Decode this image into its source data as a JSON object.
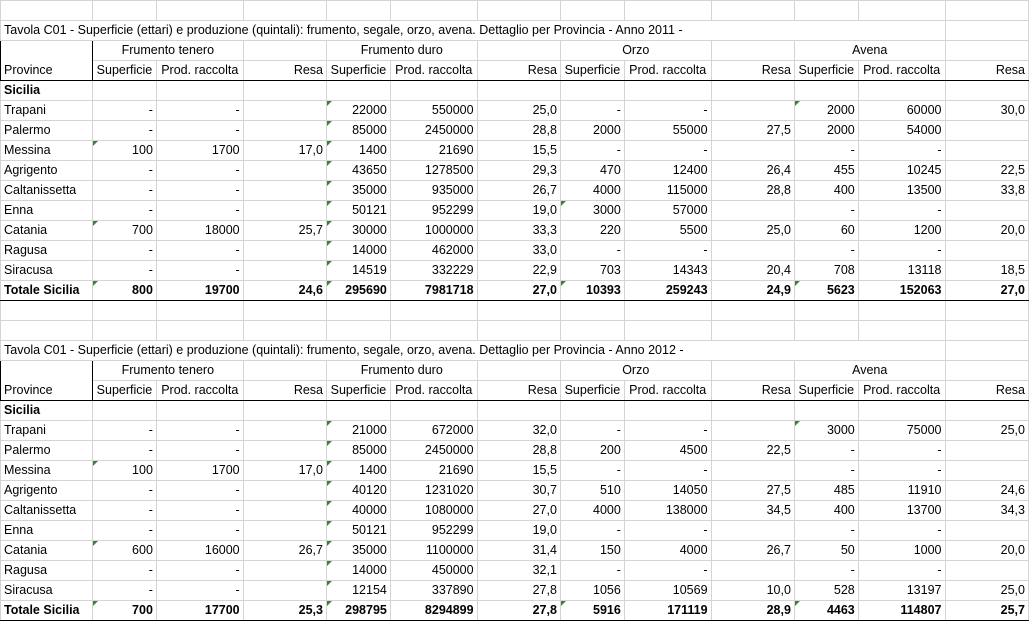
{
  "tables": [
    {
      "title": "Tavola C01 - Superficie (ettari) e produzione (quintali): frumento, segale, orzo, avena. Dettaglio per Provincia - Anno 2011 -",
      "province_header": "Province",
      "groups": [
        "Frumento tenero",
        "Frumento duro",
        "Orzo",
        "Avena"
      ],
      "subheaders": [
        "Superficie",
        "Prod. raccolta",
        "Resa",
        "Superficie",
        "Prod. raccolta",
        "Resa",
        "Superficie",
        "Prod. raccolta",
        "Resa",
        "Superficie",
        "Prod. raccolta",
        "Resa"
      ],
      "region": "Sicilia",
      "rows": [
        {
          "name": "Trapani",
          "values": [
            "-",
            "-",
            "",
            "22000",
            "550000",
            "25,0",
            "-",
            "-",
            "",
            "2000",
            "60000",
            "30,0"
          ]
        },
        {
          "name": "Palermo",
          "values": [
            "-",
            "-",
            "",
            "85000",
            "2450000",
            "28,8",
            "2000",
            "55000",
            "27,5",
            "2000",
            "54000",
            ""
          ]
        },
        {
          "name": "Messina",
          "values": [
            "100",
            "1700",
            "17,0",
            "1400",
            "21690",
            "15,5",
            "-",
            "-",
            "",
            "-",
            "-",
            ""
          ]
        },
        {
          "name": "Agrigento",
          "values": [
            "-",
            "-",
            "",
            "43650",
            "1278500",
            "29,3",
            "470",
            "12400",
            "26,4",
            "455",
            "10245",
            "22,5"
          ]
        },
        {
          "name": "Caltanissetta",
          "values": [
            "-",
            "-",
            "",
            "35000",
            "935000",
            "26,7",
            "4000",
            "115000",
            "28,8",
            "400",
            "13500",
            "33,8"
          ]
        },
        {
          "name": "Enna",
          "values": [
            "-",
            "-",
            "",
            "50121",
            "952299",
            "19,0",
            "3000",
            "57000",
            "",
            "-",
            "-",
            ""
          ]
        },
        {
          "name": "Catania",
          "values": [
            "700",
            "18000",
            "25,7",
            "30000",
            "1000000",
            "33,3",
            "220",
            "5500",
            "25,0",
            "60",
            "1200",
            "20,0"
          ]
        },
        {
          "name": "Ragusa",
          "values": [
            "-",
            "-",
            "",
            "14000",
            "462000",
            "33,0",
            "-",
            "-",
            "",
            "-",
            "-",
            ""
          ]
        },
        {
          "name": "Siracusa",
          "values": [
            "-",
            "-",
            "",
            "14519",
            "332229",
            "22,9",
            "703",
            "14343",
            "20,4",
            "708",
            "13118",
            "18,5"
          ]
        }
      ],
      "total": {
        "name": "Totale Sicilia",
        "values": [
          "800",
          "19700",
          "24,6",
          "295690",
          "7981718",
          "27,0",
          "10393",
          "259243",
          "24,9",
          "5623",
          "152063",
          "27,0"
        ]
      }
    },
    {
      "title": "Tavola C01 - Superficie (ettari) e produzione (quintali): frumento, segale, orzo, avena. Dettaglio per Provincia - Anno 2012 -",
      "province_header": "Province",
      "groups": [
        "Frumento tenero",
        "Frumento duro",
        "Orzo",
        "Avena"
      ],
      "subheaders": [
        "Superficie",
        "Prod. raccolta",
        "Resa",
        "Superficie",
        "Prod. raccolta",
        "Resa",
        "Superficie",
        "Prod. raccolta",
        "Resa",
        "Superficie",
        "Prod. raccolta",
        "Resa"
      ],
      "region": "Sicilia",
      "rows": [
        {
          "name": "Trapani",
          "values": [
            "-",
            "-",
            "",
            "21000",
            "672000",
            "32,0",
            "-",
            "-",
            "",
            "3000",
            "75000",
            "25,0"
          ]
        },
        {
          "name": "Palermo",
          "values": [
            "-",
            "-",
            "",
            "85000",
            "2450000",
            "28,8",
            "200",
            "4500",
            "22,5",
            "-",
            "-",
            ""
          ]
        },
        {
          "name": "Messina",
          "values": [
            "100",
            "1700",
            "17,0",
            "1400",
            "21690",
            "15,5",
            "-",
            "-",
            "",
            "-",
            "-",
            ""
          ]
        },
        {
          "name": "Agrigento",
          "values": [
            "-",
            "-",
            "",
            "40120",
            "1231020",
            "30,7",
            "510",
            "14050",
            "27,5",
            "485",
            "11910",
            "24,6"
          ]
        },
        {
          "name": "Caltanissetta",
          "values": [
            "-",
            "-",
            "",
            "40000",
            "1080000",
            "27,0",
            "4000",
            "138000",
            "34,5",
            "400",
            "13700",
            "34,3"
          ]
        },
        {
          "name": "Enna",
          "values": [
            "-",
            "-",
            "",
            "50121",
            "952299",
            "19,0",
            "-",
            "-",
            "",
            "-",
            "-",
            ""
          ]
        },
        {
          "name": "Catania",
          "values": [
            "600",
            "16000",
            "26,7",
            "35000",
            "1100000",
            "31,4",
            "150",
            "4000",
            "26,7",
            "50",
            "1000",
            "20,0"
          ]
        },
        {
          "name": "Ragusa",
          "values": [
            "-",
            "-",
            "",
            "14000",
            "450000",
            "32,1",
            "-",
            "-",
            "",
            "-",
            "-",
            ""
          ]
        },
        {
          "name": "Siracusa",
          "values": [
            "-",
            "-",
            "",
            "12154",
            "337890",
            "27,8",
            "1056",
            "10569",
            "10,0",
            "528",
            "13197",
            "25,0"
          ]
        }
      ],
      "total": {
        "name": "Totale Sicilia",
        "values": [
          "700",
          "17700",
          "25,3",
          "298795",
          "8294899",
          "27,8",
          "5916",
          "171119",
          "28,9",
          "4463",
          "114807",
          "25,7"
        ]
      }
    }
  ],
  "colors": {
    "gridline": "#d4d4d4",
    "border": "#000000",
    "indicator": "#2e8b2e"
  }
}
